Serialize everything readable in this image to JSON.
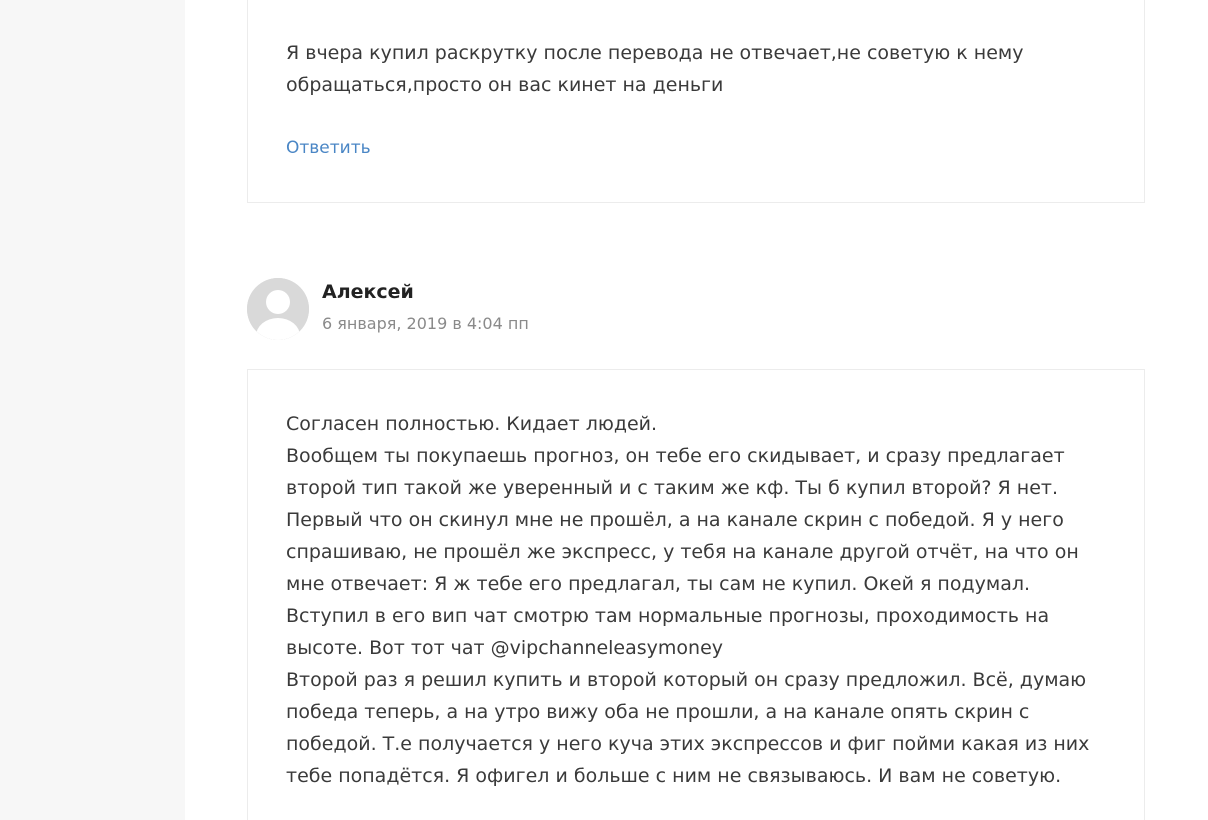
{
  "comments": [
    {
      "text": "Я вчера купил раскрутку после перевода не отвечает,не советую к нему\nобращаться,просто он вас кинет на деньги",
      "reply_label": "Ответить"
    },
    {
      "author": "Алексей",
      "date": "6 января, 2019 в 4:04 пп",
      "avatar_icon": "default-user-avatar-icon",
      "text": "Согласен полностью. Кидает людей.\nВообщем ты покупаешь прогноз, он тебе его скидывает, и сразу предлагает\nвторой тип такой же уверенный и с таким же кф. Ты б купил второй? Я нет.\nПервый что он скинул мне не прошёл, а на канале скрин с победой. Я у него\nспрашиваю, не прошёл же экспресс, у тебя на канале другой отчёт, на что он\nмне отвечает: Я ж тебе его предлагал, ты сам не купил. Окей я подумал.\nВступил в его вип чат смотрю там нормальные прогнозы, проходимость на\nвысоте. Вот тот чат @vipchanneleasymoney\nВторой раз я решил купить и второй который он сразу предложил. Всё, думаю\nпобеда теперь, а на утро вижу оба не прошли, а на канале опять скрин с\nпобедой. Т.е получается у него куча этих экспрессов и фиг пойми какая из них\nтебе попадётся. Я офигел и больше с ним не связываюсь. И вам не советую."
    }
  ],
  "colors": {
    "link": "#4a86c5",
    "page_background": "#f7f7f7",
    "text": "#3a3a3a",
    "meta": "#8a8a8a"
  }
}
